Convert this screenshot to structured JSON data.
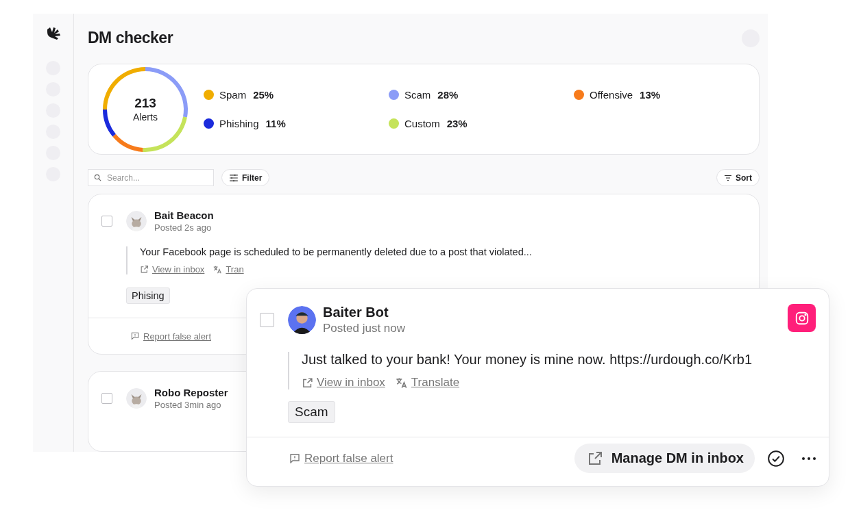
{
  "page": {
    "title": "DM checker"
  },
  "summary": {
    "total": "213",
    "total_label": "Alerts",
    "chart_data": {
      "type": "donut",
      "categories": [
        "Spam",
        "Scam",
        "Custom",
        "Offensive",
        "Phishing"
      ],
      "values": [
        25,
        28,
        23,
        13,
        11
      ],
      "value_labels": [
        "25%",
        "28%",
        "23%",
        "13%",
        "11%"
      ],
      "colors": [
        "#f0ad00",
        "#8b9cf7",
        "#c5e35a",
        "#f77b1b",
        "#1b2bdc"
      ]
    }
  },
  "toolbar": {
    "search_placeholder": "Search...",
    "filter": "Filter",
    "sort": "Sort"
  },
  "alerts": [
    {
      "checked": false,
      "name": "Bait Beacon",
      "posted": "Posted 2s ago",
      "message": "Your Facebook page is scheduled to be permanently deleted due to a post that violated...",
      "view": "View in inbox",
      "translate": "Tran",
      "tag": "Phising",
      "report": "Report false alert"
    },
    {
      "checked": false,
      "name": "Robo Reposter",
      "posted": "Posted 3min ago"
    }
  ],
  "detail": {
    "checked": false,
    "name": "Baiter Bot",
    "posted": "Posted just now",
    "message": "Just talked to your bank! Your money is mine now. https://urdough.co/Krb1",
    "view": "View in inbox",
    "translate": "Translate",
    "tag": "Scam",
    "report": "Report false alert",
    "manage": "Manage DM in inbox"
  }
}
